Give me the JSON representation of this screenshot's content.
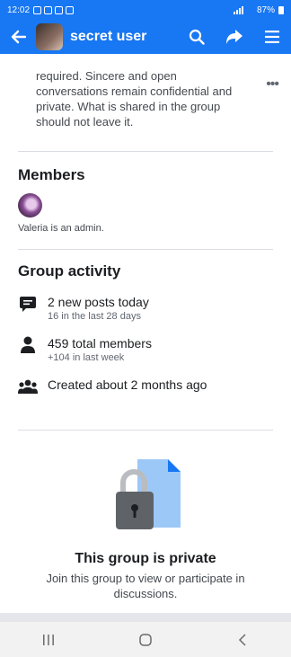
{
  "status_bar": {
    "time": "12:02",
    "battery": "87%"
  },
  "header": {
    "title": "secret user",
    "icons": [
      "back-arrow-icon",
      "search-icon",
      "share-icon",
      "menu-icon"
    ]
  },
  "intro": {
    "text": "required. Sincere and open conversations remain confidential and private. What is shared in the group should not leave it."
  },
  "members": {
    "title": "Members",
    "admin_name": "Valeria",
    "admin_suffix": " is an admin."
  },
  "activity": {
    "title": "Group activity",
    "items": [
      {
        "main": "2 new posts today",
        "sub": "16 in the last 28 days",
        "icon": "posts-icon"
      },
      {
        "main": "459 total members",
        "sub": "+104 in last week",
        "icon": "person-icon"
      },
      {
        "main": "Created about 2 months ago",
        "sub": "",
        "icon": "group-icon"
      }
    ]
  },
  "private_notice": {
    "title": "This group is private",
    "description": "Join this group to view or participate in discussions."
  },
  "colors": {
    "brand": "#1877f2",
    "text": "#1c1e21",
    "secondary": "#606770"
  }
}
